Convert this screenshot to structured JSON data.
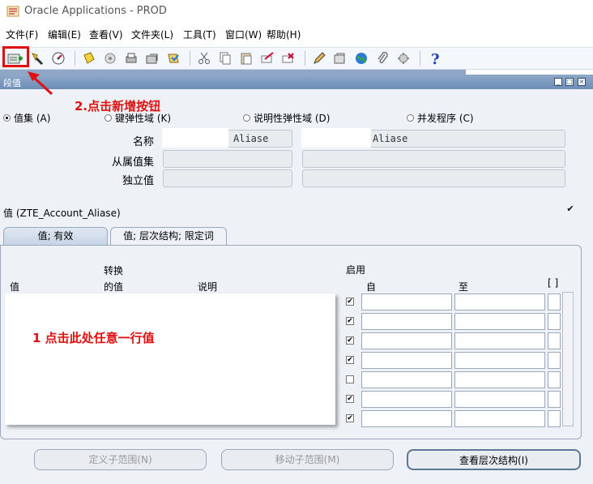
{
  "window": {
    "title": "Oracle Applications - PROD"
  },
  "menu": [
    "文件(F)",
    "编辑(E)",
    "查看(V)",
    "文件夹(L)",
    "工具(T)",
    "窗口(W)",
    "帮助(H)"
  ],
  "toolbar": {
    "icons": [
      "new-record-icon",
      "flashlight-icon",
      "navigator-icon",
      "save-icon",
      "translate-icon",
      "print-icon",
      "close-form-icon",
      "cut-icon",
      "copy-icon",
      "paste-icon",
      "clear-record-icon",
      "delete-icon",
      "edit-field-icon",
      "zoom-icon",
      "globe-icon",
      "attachment-icon",
      "folder-tools-icon",
      "help-icon"
    ]
  },
  "subwindow": {
    "title": "段值"
  },
  "annotations": {
    "step2": "2.点击新增按钮",
    "step1": "1 点击此处任意一行值"
  },
  "radios": [
    {
      "label": "值集 (A)",
      "selected": true
    },
    {
      "label": "键弹性域 (K)",
      "selected": false
    },
    {
      "label": "说明性弹性域 (D)",
      "selected": false
    },
    {
      "label": "并发程序 (C)",
      "selected": false
    }
  ],
  "form": {
    "name_label": "名称",
    "dependent_label": "从属值集",
    "independent_label": "独立值",
    "name_value1": "Aliase",
    "name_value2": "Aliase"
  },
  "section": {
    "label": "值 (ZTE_Account_Aliase)",
    "check": "✔"
  },
  "tabs": [
    {
      "label": "值; 有效"
    },
    {
      "label": "值; 层次结构; 限定词"
    }
  ],
  "columns": {
    "value": "值",
    "translated1": "转换",
    "translated2": "的值",
    "description": "说明",
    "enabled": "启用",
    "from": "自",
    "to": "至",
    "bracket": "[ ]"
  },
  "rows": [
    {
      "enabled": true
    },
    {
      "enabled": true
    },
    {
      "enabled": true
    },
    {
      "enabled": true
    },
    {
      "enabled": false
    },
    {
      "enabled": true
    },
    {
      "enabled": true
    }
  ],
  "buttons": {
    "define_child": "定义子范围(N)",
    "move_child": "移动子范围(M)",
    "view_hierarchy": "查看层次结构(I)"
  },
  "colors": {
    "annotation": "#e01010",
    "title_gradient": "#7d9bc4"
  }
}
